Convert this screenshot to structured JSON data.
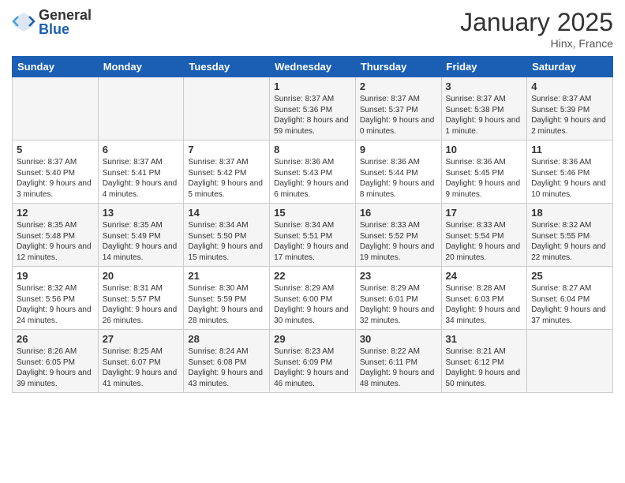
{
  "logo": {
    "general": "General",
    "blue": "Blue"
  },
  "header": {
    "month": "January 2025",
    "location": "Hinx, France"
  },
  "weekdays": [
    "Sunday",
    "Monday",
    "Tuesday",
    "Wednesday",
    "Thursday",
    "Friday",
    "Saturday"
  ],
  "weeks": [
    [
      {
        "day": "",
        "info": ""
      },
      {
        "day": "",
        "info": ""
      },
      {
        "day": "",
        "info": ""
      },
      {
        "day": "1",
        "info": "Sunrise: 8:37 AM\nSunset: 5:36 PM\nDaylight: 8 hours\nand 59 minutes."
      },
      {
        "day": "2",
        "info": "Sunrise: 8:37 AM\nSunset: 5:37 PM\nDaylight: 9 hours\nand 0 minutes."
      },
      {
        "day": "3",
        "info": "Sunrise: 8:37 AM\nSunset: 5:38 PM\nDaylight: 9 hours\nand 1 minute."
      },
      {
        "day": "4",
        "info": "Sunrise: 8:37 AM\nSunset: 5:39 PM\nDaylight: 9 hours\nand 2 minutes."
      }
    ],
    [
      {
        "day": "5",
        "info": "Sunrise: 8:37 AM\nSunset: 5:40 PM\nDaylight: 9 hours\nand 3 minutes."
      },
      {
        "day": "6",
        "info": "Sunrise: 8:37 AM\nSunset: 5:41 PM\nDaylight: 9 hours\nand 4 minutes."
      },
      {
        "day": "7",
        "info": "Sunrise: 8:37 AM\nSunset: 5:42 PM\nDaylight: 9 hours\nand 5 minutes."
      },
      {
        "day": "8",
        "info": "Sunrise: 8:36 AM\nSunset: 5:43 PM\nDaylight: 9 hours\nand 6 minutes."
      },
      {
        "day": "9",
        "info": "Sunrise: 8:36 AM\nSunset: 5:44 PM\nDaylight: 9 hours\nand 8 minutes."
      },
      {
        "day": "10",
        "info": "Sunrise: 8:36 AM\nSunset: 5:45 PM\nDaylight: 9 hours\nand 9 minutes."
      },
      {
        "day": "11",
        "info": "Sunrise: 8:36 AM\nSunset: 5:46 PM\nDaylight: 9 hours\nand 10 minutes."
      }
    ],
    [
      {
        "day": "12",
        "info": "Sunrise: 8:35 AM\nSunset: 5:48 PM\nDaylight: 9 hours\nand 12 minutes."
      },
      {
        "day": "13",
        "info": "Sunrise: 8:35 AM\nSunset: 5:49 PM\nDaylight: 9 hours\nand 14 minutes."
      },
      {
        "day": "14",
        "info": "Sunrise: 8:34 AM\nSunset: 5:50 PM\nDaylight: 9 hours\nand 15 minutes."
      },
      {
        "day": "15",
        "info": "Sunrise: 8:34 AM\nSunset: 5:51 PM\nDaylight: 9 hours\nand 17 minutes."
      },
      {
        "day": "16",
        "info": "Sunrise: 8:33 AM\nSunset: 5:52 PM\nDaylight: 9 hours\nand 19 minutes."
      },
      {
        "day": "17",
        "info": "Sunrise: 8:33 AM\nSunset: 5:54 PM\nDaylight: 9 hours\nand 20 minutes."
      },
      {
        "day": "18",
        "info": "Sunrise: 8:32 AM\nSunset: 5:55 PM\nDaylight: 9 hours\nand 22 minutes."
      }
    ],
    [
      {
        "day": "19",
        "info": "Sunrise: 8:32 AM\nSunset: 5:56 PM\nDaylight: 9 hours\nand 24 minutes."
      },
      {
        "day": "20",
        "info": "Sunrise: 8:31 AM\nSunset: 5:57 PM\nDaylight: 9 hours\nand 26 minutes."
      },
      {
        "day": "21",
        "info": "Sunrise: 8:30 AM\nSunset: 5:59 PM\nDaylight: 9 hours\nand 28 minutes."
      },
      {
        "day": "22",
        "info": "Sunrise: 8:29 AM\nSunset: 6:00 PM\nDaylight: 9 hours\nand 30 minutes."
      },
      {
        "day": "23",
        "info": "Sunrise: 8:29 AM\nSunset: 6:01 PM\nDaylight: 9 hours\nand 32 minutes."
      },
      {
        "day": "24",
        "info": "Sunrise: 8:28 AM\nSunset: 6:03 PM\nDaylight: 9 hours\nand 34 minutes."
      },
      {
        "day": "25",
        "info": "Sunrise: 8:27 AM\nSunset: 6:04 PM\nDaylight: 9 hours\nand 37 minutes."
      }
    ],
    [
      {
        "day": "26",
        "info": "Sunrise: 8:26 AM\nSunset: 6:05 PM\nDaylight: 9 hours\nand 39 minutes."
      },
      {
        "day": "27",
        "info": "Sunrise: 8:25 AM\nSunset: 6:07 PM\nDaylight: 9 hours\nand 41 minutes."
      },
      {
        "day": "28",
        "info": "Sunrise: 8:24 AM\nSunset: 6:08 PM\nDaylight: 9 hours\nand 43 minutes."
      },
      {
        "day": "29",
        "info": "Sunrise: 8:23 AM\nSunset: 6:09 PM\nDaylight: 9 hours\nand 46 minutes."
      },
      {
        "day": "30",
        "info": "Sunrise: 8:22 AM\nSunset: 6:11 PM\nDaylight: 9 hours\nand 48 minutes."
      },
      {
        "day": "31",
        "info": "Sunrise: 8:21 AM\nSunset: 6:12 PM\nDaylight: 9 hours\nand 50 minutes."
      },
      {
        "day": "",
        "info": ""
      }
    ]
  ]
}
